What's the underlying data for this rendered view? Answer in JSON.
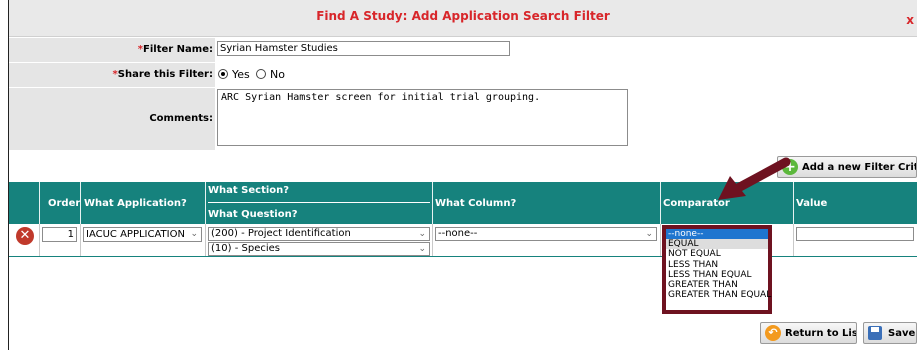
{
  "page": {
    "title": "Find A Study: Add Application Search Filter",
    "close_label": "x"
  },
  "form": {
    "filter_name": {
      "required_mark": "*",
      "label": "Filter Name:",
      "value": "Syrian Hamster Studies"
    },
    "share": {
      "required_mark": "*",
      "label": "Share this Filter:",
      "options": [
        "Yes",
        "No"
      ],
      "selected": "Yes"
    },
    "comments": {
      "label": "Comments:",
      "value": "ARC Syrian Hamster screen for initial trial grouping."
    }
  },
  "add_criteria_label": "Add a new Filter Criteria",
  "grid": {
    "headers": {
      "order": "Order",
      "application": "What Application?",
      "section": "What Section?",
      "question": "What Question?",
      "column": "What Column?",
      "comparator": "Comparator",
      "value": "Value"
    },
    "row": {
      "order": "1",
      "application": "IACUC APPLICATION",
      "section": "(200) - Project Identification",
      "question": "(10) - Species",
      "column": "--none--",
      "comparator_selected": "--none--",
      "value": ""
    }
  },
  "comparator_options": [
    "--none--",
    "EQUAL",
    "NOT EQUAL",
    "LESS THAN",
    "LESS THAN EQUAL",
    "GREATER THAN",
    "GREATER THAN EQUAL"
  ],
  "buttons": {
    "return_label": "Return to List",
    "save_label": "Save"
  },
  "colors": {
    "header_teal": "#16827d",
    "title_red": "#d8262a",
    "dropdown_border": "#6e1220",
    "arrow": "#6e1220",
    "selected_option": "#1e75cf"
  }
}
